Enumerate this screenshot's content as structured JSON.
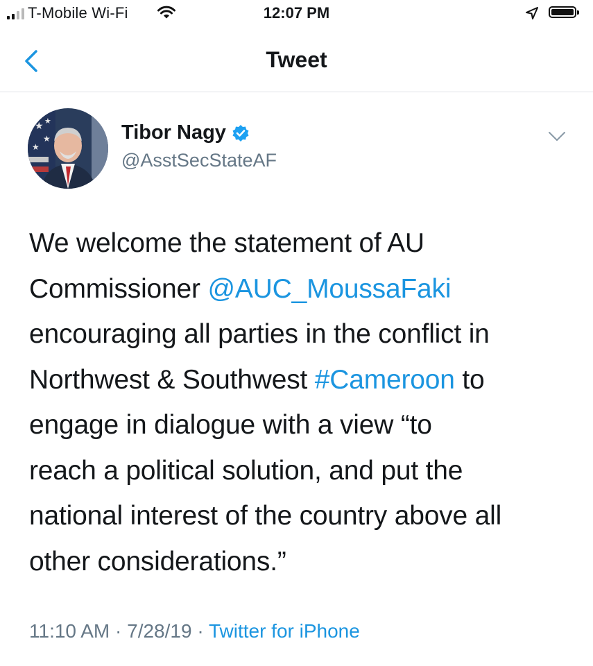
{
  "status_bar": {
    "carrier": "T-Mobile Wi-Fi",
    "time": "12:07 PM"
  },
  "nav": {
    "title": "Tweet"
  },
  "tweet": {
    "author_name": "Tibor Nagy",
    "author_handle": "@AsstSecStateAF",
    "verified": true,
    "text_lines": [
      [
        "We welcome the statement of AU"
      ],
      [
        "Commissioner ",
        "@AUC_MoussaFaki"
      ],
      [
        "encouraging all parties in the conflict in"
      ],
      [
        "Northwest & Southwest ",
        "#Cameroon",
        " to"
      ],
      [
        "engage in dialogue with a view “to"
      ],
      [
        "reach a political solution, and put the"
      ],
      [
        "national interest of the country above all"
      ],
      [
        "other considerations.”"
      ]
    ],
    "mention": "@AUC_MoussaFaki",
    "hashtag": "#Cameroon",
    "time": "11:10 AM",
    "date": "7/28/19",
    "source": "Twitter for iPhone",
    "separator": " · "
  },
  "icons": {
    "signal": "cellular-signal-icon",
    "wifi": "wifi-icon",
    "location": "location-arrow-icon",
    "battery": "battery-icon",
    "back": "chevron-left-icon",
    "verified": "verified-badge-icon",
    "caret": "chevron-down-icon"
  },
  "colors": {
    "link": "#1b95e0",
    "secondary_text": "#657786",
    "primary_text": "#14171a",
    "divider": "#dfe3e6"
  }
}
